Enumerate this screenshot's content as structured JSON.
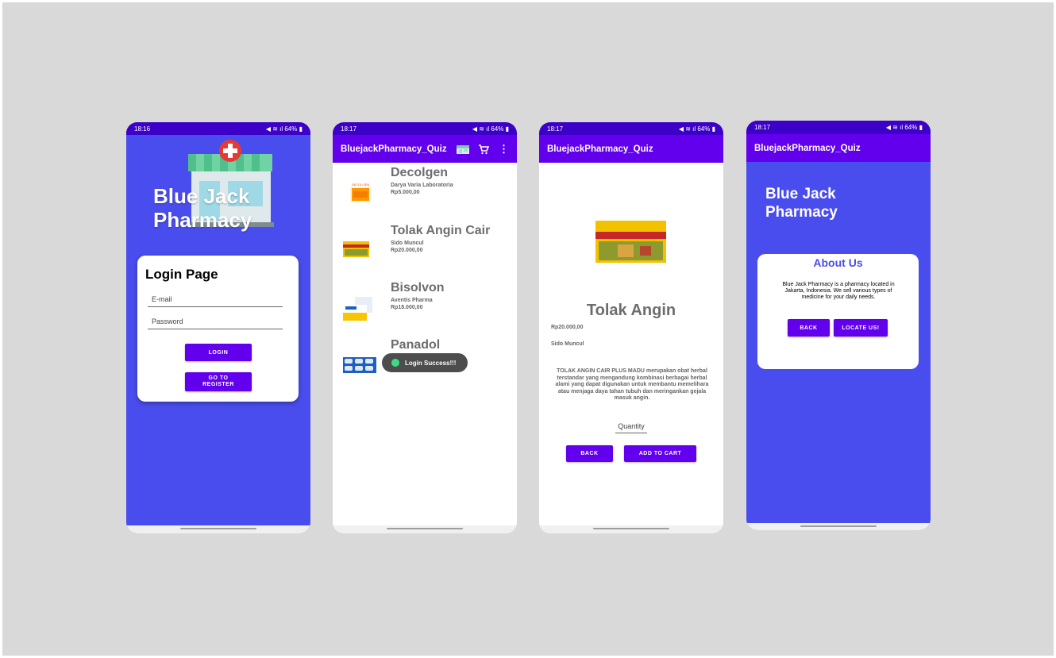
{
  "colors": {
    "accent": "#6200ee",
    "status": "#3c00c8",
    "background_blue": "#4a4ded",
    "canvas": "#d9d9d9"
  },
  "login_screen": {
    "status": {
      "time": "18:16",
      "battery": "64%"
    },
    "app_title_line1": "Blue Jack",
    "app_title_line2": "Pharmacy",
    "card_title": "Login Page",
    "email_placeholder": "E-mail",
    "password_placeholder": "Password",
    "login_button": "LOGIN",
    "register_button_line1": "GO TO",
    "register_button_line2": "REGISTER"
  },
  "product_screen": {
    "status": {
      "time": "18:17",
      "battery": "64%"
    },
    "appbar_title": "BluejackPharmacy_Quiz",
    "icons": [
      "medicine-box-icon",
      "cart-icon",
      "more-vert-icon"
    ],
    "items": [
      {
        "name": "Decolgen",
        "manufacturer": "Darya Varia Laboratoria",
        "price": "Rp5.000,00"
      },
      {
        "name": "Tolak Angin Cair",
        "manufacturer": "Sido Muncul",
        "price": "Rp20.000,00"
      },
      {
        "name": "Bisolvon",
        "manufacturer": "Aventis Pharma",
        "price": "Rp18.000,00"
      },
      {
        "name": "Panadol",
        "manufacturer": "",
        "price": ""
      }
    ],
    "toast": "Login Success!!!"
  },
  "detail_screen": {
    "status": {
      "time": "18:17",
      "battery": "64%"
    },
    "appbar_title": "BluejackPharmacy_Quiz",
    "product_name": "Tolak Angin",
    "price": "Rp20.000,00",
    "manufacturer": "Sido Muncul",
    "description": "TOLAK ANGIN CAIR PLUS MADU merupakan obat herbal terstandar yang mengandung kombinasi berbagai herbal alami yang dapat digunakan untuk membantu memelihara atau menjaga daya tahan tubuh dan meringankan gejala masuk angin.",
    "quantity_placeholder": "Quantity",
    "back_button": "BACK",
    "add_button": "ADD TO CART"
  },
  "about_screen": {
    "status": {
      "time": "18:17",
      "battery": "64%"
    },
    "appbar_title": "BluejackPharmacy_Quiz",
    "title_line1": "Blue Jack",
    "title_line2": "Pharmacy",
    "card_title": "About Us",
    "card_text": "Blue Jack Pharmacy is a pharmacy located in Jakarta, Indonesia. We sell various types of medicine for your daily needs.",
    "back_button": "BACK",
    "locate_button": "LOCATE US!"
  }
}
